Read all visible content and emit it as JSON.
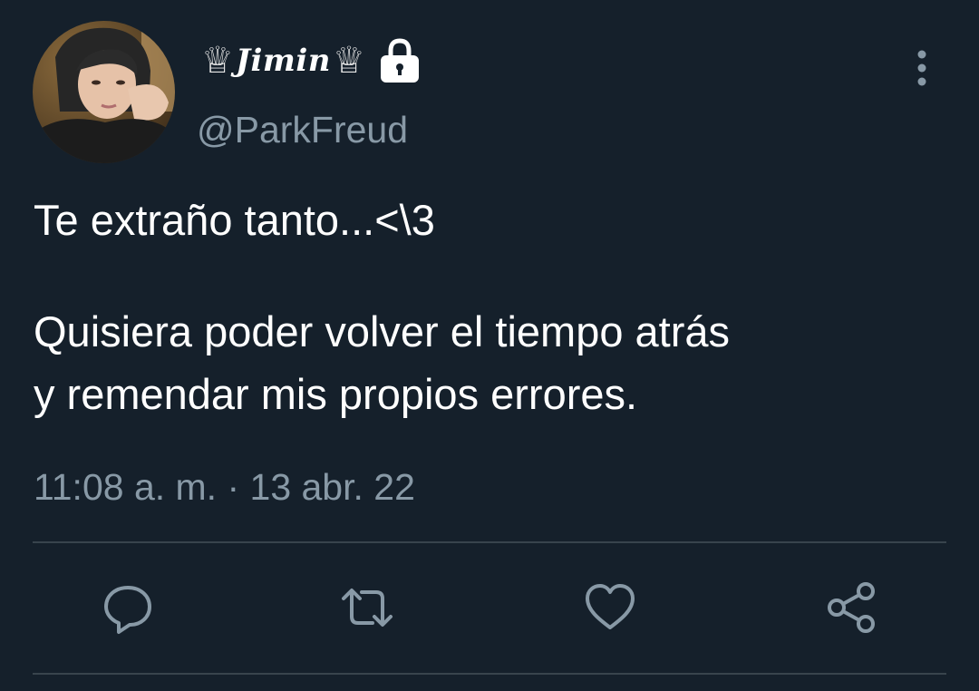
{
  "tweet": {
    "display_name": "Jimin",
    "name_prefix_glyph": "♕",
    "name_suffix_glyph": "♕",
    "handle": "@ParkFreud",
    "protected_icon": "lock-icon",
    "menu_icon": "more-vertical-icon",
    "lines": [
      "Te extraño tanto...<\\3",
      "Quisiera poder volver el tiempo atrás",
      "y remendar mis propios errores."
    ],
    "timestamp": "11:08 a. m. · 13 abr. 22"
  },
  "actions": {
    "reply": "reply-icon",
    "retweet": "retweet-icon",
    "like": "heart-icon",
    "share": "share-icon"
  },
  "colors": {
    "background": "#15202b",
    "secondary_text": "#8899a6",
    "divider": "#38444d",
    "text": "#ffffff"
  }
}
